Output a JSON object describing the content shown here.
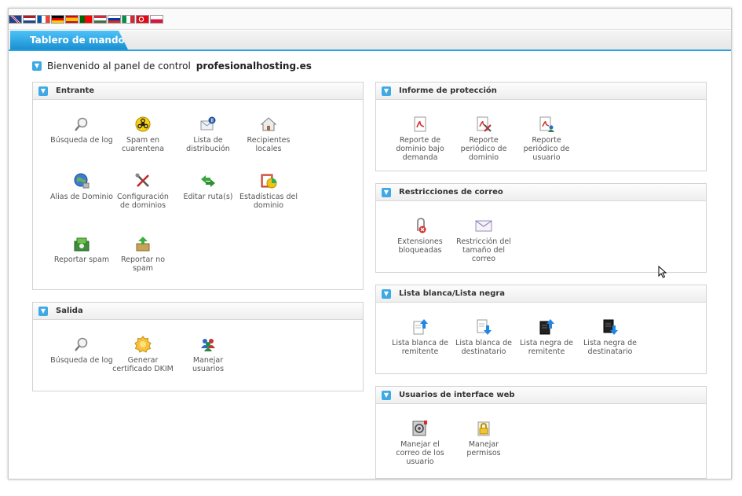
{
  "tab_title": "Tablero de mando",
  "welcome": {
    "text": "Bienvenido al panel de control",
    "domain": "profesionalhosting.es"
  },
  "panels": {
    "entrante": {
      "title": "Entrante",
      "items": [
        "Búsqueda de log",
        "Spam en cuarentena",
        "Lista de distribución",
        "Recipientes locales",
        "Alias de Dominio",
        "Configuración de dominios",
        "Editar ruta(s)",
        "Estadísticas del dominio",
        "Reportar spam",
        "Reportar no spam"
      ]
    },
    "salida": {
      "title": "Salida",
      "items": [
        "Búsqueda de log",
        "Generar certificado DKIM",
        "Manejar usuarios"
      ]
    },
    "proteccion": {
      "title": "Informe de protección",
      "items": [
        "Reporte de dominio bajo demanda",
        "Reporte periódico de dominio",
        "Reporte periódico de usuario"
      ]
    },
    "restricciones": {
      "title": "Restricciones de correo",
      "items": [
        "Extensiones bloqueadas",
        "Restricción del tamaño del correo"
      ]
    },
    "lista": {
      "title": "Lista blanca/Lista negra",
      "items": [
        "Lista blanca de remitente",
        "Lista blanca de destinatario",
        "Lista negra de remitente",
        "Lista negra de destinatario"
      ]
    },
    "usuarios": {
      "title": "Usuarios de interface web",
      "items": [
        "Manejar el correo de los usuario",
        "Manejar permisos"
      ]
    }
  },
  "colors": {
    "accent": "#2aa3e0",
    "tab_top": "#4ec2f7",
    "tab_bottom": "#1a8fd1"
  }
}
